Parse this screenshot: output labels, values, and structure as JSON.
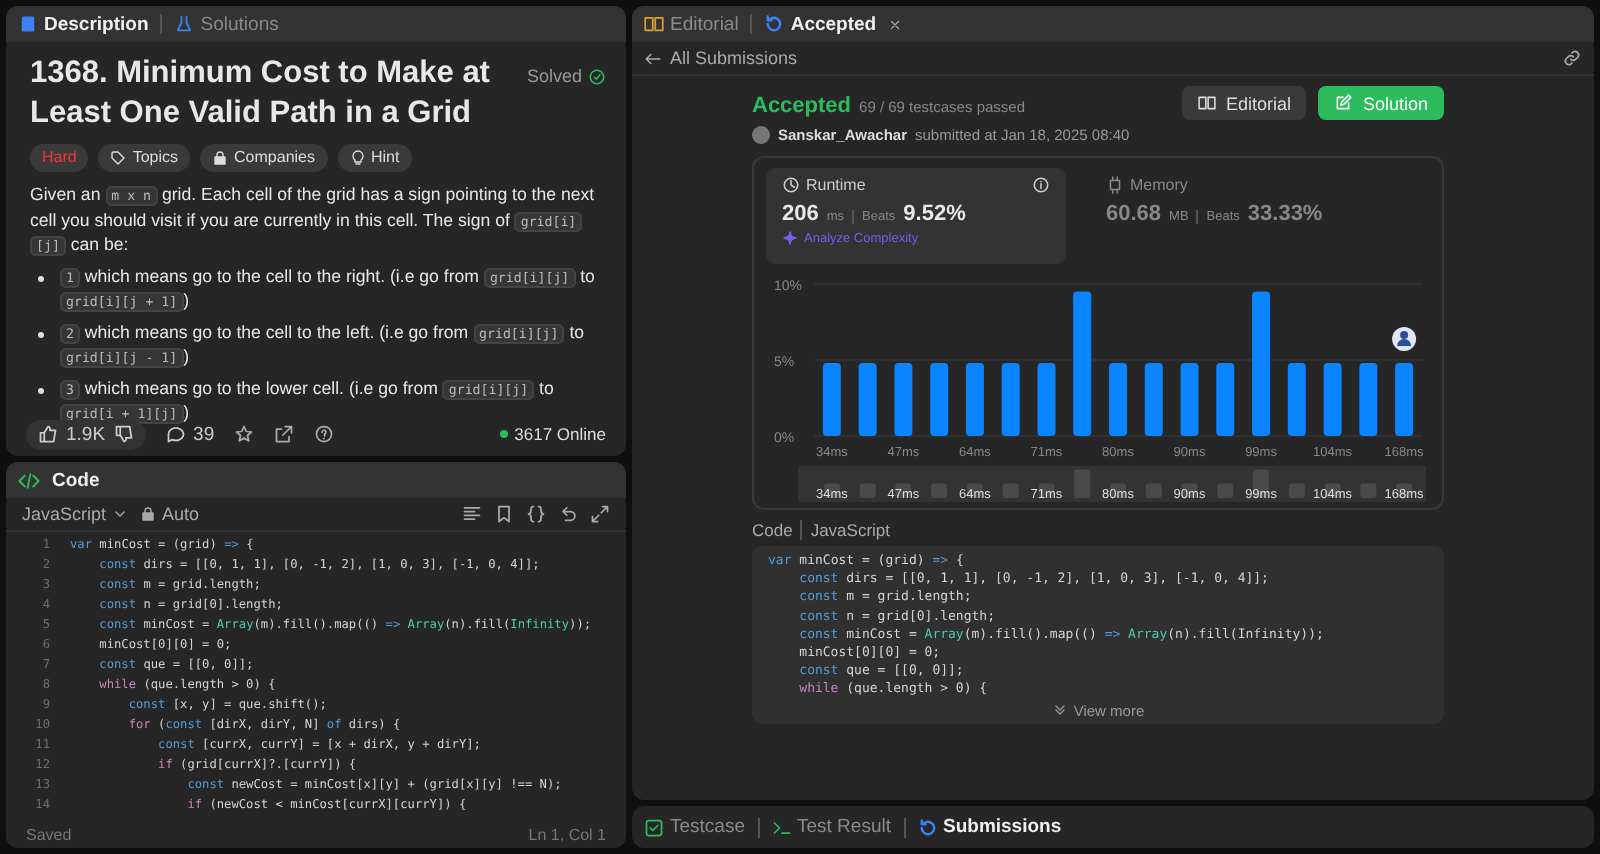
{
  "description_panel": {
    "tabs": [
      {
        "label": "Description",
        "selected": true
      },
      {
        "label": "Solutions",
        "selected": false
      }
    ],
    "title": "1368. Minimum Cost to Make at Least One Valid Path in a Grid",
    "status": "Solved",
    "tags": [
      {
        "label": "Hard",
        "kind": "difficulty"
      },
      {
        "label": "Topics",
        "kind": "topics"
      },
      {
        "label": "Companies",
        "kind": "companies"
      },
      {
        "label": "Hint",
        "kind": "hint"
      }
    ],
    "paragraph": [
      {
        "t": "Given an ",
        "kind": "text"
      },
      {
        "t": "m x n",
        "kind": "code"
      },
      {
        "t": " grid. Each cell of the grid has a sign pointing to the next cell you should visit if you are currently in this cell. The sign of ",
        "kind": "text"
      },
      {
        "t": "grid[i][j]",
        "kind": "code"
      },
      {
        "t": " can be:",
        "kind": "text"
      }
    ],
    "bullets": [
      [
        {
          "t": "1",
          "kind": "code"
        },
        {
          "t": " which means go to the cell to the right. (i.e go from ",
          "kind": "text"
        },
        {
          "t": "grid[i][j]",
          "kind": "code"
        },
        {
          "t": " to ",
          "kind": "text"
        },
        {
          "t": "grid[i][j + 1]",
          "kind": "code"
        },
        {
          "t": ")",
          "kind": "text"
        }
      ],
      [
        {
          "t": "2",
          "kind": "code"
        },
        {
          "t": " which means go to the cell to the left. (i.e go from ",
          "kind": "text"
        },
        {
          "t": "grid[i][j]",
          "kind": "code"
        },
        {
          "t": " to ",
          "kind": "text"
        },
        {
          "t": "grid[i][j - 1]",
          "kind": "code"
        },
        {
          "t": ")",
          "kind": "text"
        }
      ],
      [
        {
          "t": "3",
          "kind": "code"
        },
        {
          "t": " which means go to the lower cell. (i.e go from ",
          "kind": "text"
        },
        {
          "t": "grid[i][j]",
          "kind": "code"
        },
        {
          "t": " to ",
          "kind": "text"
        },
        {
          "t": "grid[i + 1][j]",
          "kind": "code"
        },
        {
          "t": ")",
          "kind": "text"
        }
      ]
    ],
    "likes": "1.9K",
    "comments": "39",
    "online": "3617 Online"
  },
  "code_panel": {
    "title": "Code",
    "language": "JavaScript",
    "mode": "Auto",
    "status": "Saved",
    "cursor": "Ln 1, Col 1",
    "lines": [
      {
        "n": "1",
        "seg": [
          {
            "t": "var",
            "kind": "keyword"
          },
          {
            "t": " minCost = (grid) ",
            "kind": "plain"
          },
          {
            "t": "=>",
            "kind": "keyword"
          },
          {
            "t": " {",
            "kind": "plain"
          }
        ]
      },
      {
        "n": "2",
        "seg": [
          {
            "t": "    const",
            "kind": "keyword"
          },
          {
            "t": " dirs = [[0, 1, 1], [0, -1, 2], [1, 0, 3], [-1, 0, 4]];",
            "kind": "plain"
          }
        ]
      },
      {
        "n": "3",
        "seg": [
          {
            "t": "    const",
            "kind": "keyword"
          },
          {
            "t": " m = grid.length;",
            "kind": "plain"
          }
        ]
      },
      {
        "n": "4",
        "seg": [
          {
            "t": "    const",
            "kind": "keyword"
          },
          {
            "t": " n = grid[0].length;",
            "kind": "plain"
          }
        ]
      },
      {
        "n": "5",
        "seg": [
          {
            "t": "    const",
            "kind": "keyword"
          },
          {
            "t": " minCost = ",
            "kind": "plain"
          },
          {
            "t": "Array",
            "kind": "type"
          },
          {
            "t": "(m).fill().map(() ",
            "kind": "plain"
          },
          {
            "t": "=>",
            "kind": "keyword"
          },
          {
            "t": " Array",
            "kind": "type"
          },
          {
            "t": "(n).fill(",
            "kind": "plain"
          },
          {
            "t": "Infinity",
            "kind": "type"
          },
          {
            "t": "));",
            "kind": "plain"
          }
        ]
      },
      {
        "n": "6",
        "seg": [
          {
            "t": "    minCost[0][0] = 0;",
            "kind": "plain"
          }
        ]
      },
      {
        "n": "7",
        "seg": [
          {
            "t": "    const",
            "kind": "keyword"
          },
          {
            "t": " que = [[0, 0]];",
            "kind": "plain"
          }
        ]
      },
      {
        "n": "8",
        "seg": [
          {
            "t": "    while",
            "kind": "control"
          },
          {
            "t": " (que.length > 0) {",
            "kind": "plain"
          }
        ]
      },
      {
        "n": "9",
        "seg": [
          {
            "t": "        const",
            "kind": "keyword"
          },
          {
            "t": " [x, y] = que.shift();",
            "kind": "plain"
          }
        ]
      },
      {
        "n": "10",
        "seg": [
          {
            "t": "        for",
            "kind": "control"
          },
          {
            "t": " (",
            "kind": "plain"
          },
          {
            "t": "const",
            "kind": "keyword"
          },
          {
            "t": " [dirX, dirY, N] ",
            "kind": "plain"
          },
          {
            "t": "of",
            "kind": "keyword"
          },
          {
            "t": " dirs) {",
            "kind": "plain"
          }
        ]
      },
      {
        "n": "11",
        "seg": [
          {
            "t": "            const",
            "kind": "keyword"
          },
          {
            "t": " [currX, currY] = [x + dirX, y + dirY];",
            "kind": "plain"
          }
        ]
      },
      {
        "n": "12",
        "seg": [
          {
            "t": "            if",
            "kind": "control"
          },
          {
            "t": " (grid[currX]?.[currY]) {",
            "kind": "plain"
          }
        ]
      },
      {
        "n": "13",
        "seg": [
          {
            "t": "                const",
            "kind": "keyword"
          },
          {
            "t": " newCost = minCost[x][y] + (grid[x][y] !== N);",
            "kind": "plain"
          }
        ]
      },
      {
        "n": "14",
        "seg": [
          {
            "t": "                if",
            "kind": "control"
          },
          {
            "t": " (newCost < minCost[currX][currY]) {",
            "kind": "plain"
          }
        ]
      }
    ]
  },
  "submission_panel": {
    "tabs": [
      {
        "label": "Editorial",
        "selected": false
      },
      {
        "label": "Accepted",
        "selected": true
      }
    ],
    "back_link": "All Submissions",
    "result": "Accepted",
    "testcases": "69 / 69 testcases passed",
    "user": "Sanskar_Awachar",
    "submitted": "submitted at Jan 18, 2025 08:40",
    "buttons": [
      {
        "label": "Editorial",
        "kind": "secondary"
      },
      {
        "label": "Solution",
        "kind": "primary"
      }
    ],
    "metrics": [
      {
        "label": "Runtime",
        "value": "206",
        "unit": "ms",
        "beats_label": "Beats",
        "beats": "9.52%",
        "link": "Analyze Complexity",
        "selected": true
      },
      {
        "label": "Memory",
        "value": "60.68",
        "unit": "MB",
        "beats_label": "Beats",
        "beats": "33.33%",
        "selected": false
      }
    ],
    "chart_data": {
      "type": "bar",
      "categories": [
        "34ms",
        null,
        "47ms",
        null,
        "64ms",
        null,
        "71ms",
        null,
        "80ms",
        null,
        "90ms",
        null,
        "99ms",
        null,
        "104ms",
        null,
        "168ms"
      ],
      "series": [
        {
          "color": "#0a84ff",
          "values": [
            4.8,
            4.8,
            4.8,
            4.8,
            4.8,
            4.8,
            4.8,
            9.5,
            4.8,
            4.8,
            4.8,
            4.8,
            9.5,
            4.8,
            4.8,
            4.8,
            4.8
          ]
        }
      ],
      "ylim": [
        0,
        10
      ],
      "yticks": [
        {
          "value": 0,
          "label": "0%"
        },
        {
          "value": 5,
          "label": "5%"
        },
        {
          "value": 10,
          "label": "10%"
        }
      ]
    },
    "navigator_labels": [
      "34ms",
      "47ms",
      "64ms",
      "71ms",
      "80ms",
      "90ms",
      "99ms",
      "104ms",
      "168ms"
    ],
    "code_label": "Code",
    "code_language": "JavaScript",
    "code_lines": [
      [
        {
          "t": "var",
          "kind": "keyword"
        },
        {
          "t": " minCost = (grid) ",
          "kind": "plain"
        },
        {
          "t": "=>",
          "kind": "keyword"
        },
        {
          "t": " {",
          "kind": "plain"
        }
      ],
      [
        {
          "t": "    const",
          "kind": "keyword"
        },
        {
          "t": " dirs = [[0, 1, 1], [0, -1, 2], [1, 0, 3], [-1, 0, 4]];",
          "kind": "plain"
        }
      ],
      [
        {
          "t": "    const",
          "kind": "keyword"
        },
        {
          "t": " m = grid.length;",
          "kind": "plain"
        }
      ],
      [
        {
          "t": "    const",
          "kind": "keyword"
        },
        {
          "t": " n = grid[0].length;",
          "kind": "plain"
        }
      ],
      [
        {
          "t": "    const",
          "kind": "keyword"
        },
        {
          "t": " minCost = ",
          "kind": "plain"
        },
        {
          "t": "Array",
          "kind": "type"
        },
        {
          "t": "(m).fill().map(() ",
          "kind": "plain"
        },
        {
          "t": "=>",
          "kind": "keyword"
        },
        {
          "t": " Array",
          "kind": "type"
        },
        {
          "t": "(n).fill(Infinity));",
          "kind": "plain"
        }
      ],
      [
        {
          "t": "    minCost[0][0] = 0;",
          "kind": "plain"
        }
      ],
      [
        {
          "t": "    const",
          "kind": "keyword"
        },
        {
          "t": " que = [[0, 0]];",
          "kind": "plain"
        }
      ],
      [
        {
          "t": "    while",
          "kind": "control"
        },
        {
          "t": " (que.length > 0) {",
          "kind": "plain"
        }
      ]
    ],
    "view_more": "View more"
  },
  "bottom_tabs": [
    {
      "label": "Testcase",
      "selected": false
    },
    {
      "label": "Test Result",
      "selected": false
    },
    {
      "label": "Submissions",
      "selected": true
    }
  ]
}
